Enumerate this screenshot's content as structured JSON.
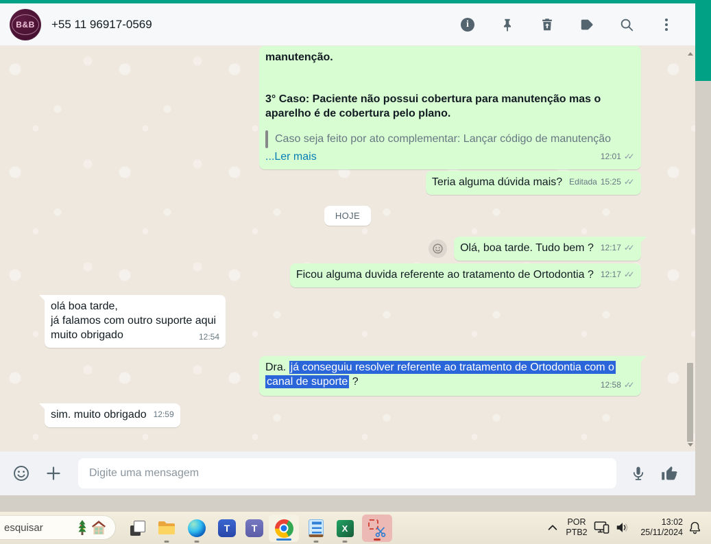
{
  "colors": {
    "accent_teal": "#00a184",
    "outgoing_bubble": "#d9fdd3",
    "incoming_bubble": "#ffffff",
    "selection_blue": "#2a66d9",
    "link_blue": "#027eb5",
    "header_icon_gray": "#54656f",
    "chrome_active_underline": "#2d7dd2",
    "snip_active_bg": "#edb9b4"
  },
  "header": {
    "avatar_text": "B&B",
    "phone": "+55 11 96917-0569"
  },
  "chat": {
    "date_divider": "HOJE",
    "messages": [
      {
        "direction": "outgoing",
        "line1": "manutenção.",
        "line2": "3° Caso: Paciente não possui cobertura para manutenção mas o aparelho é de cobertura pelo plano.",
        "quote": "Caso seja feito por ato complementar: Lançar código de manutenção",
        "read_more": "...Ler mais",
        "time": "12:01"
      },
      {
        "direction": "outgoing",
        "text": "Teria alguma dúvida mais?",
        "meta": "Editada",
        "time": "15:25"
      },
      {
        "direction": "outgoing",
        "text": "Olá, boa tarde. Tudo bem ?",
        "time": "12:17"
      },
      {
        "direction": "outgoing",
        "text": "Ficou alguma duvida referente ao tratamento de Ortodontia ?",
        "time": "12:17"
      },
      {
        "direction": "incoming",
        "lines": [
          "olá boa tarde,",
          "já falamos com outro suporte aqui",
          "muito obrigado"
        ],
        "time": "12:54"
      },
      {
        "direction": "outgoing",
        "prefix": "Dra. ",
        "selected": "já conseguiu resolver referente ao tratamento de Ortodontia com o canal de suporte",
        "suffix": " ?",
        "time": "12:58"
      },
      {
        "direction": "incoming",
        "text": "sim. muito obrigado",
        "time": "12:59"
      }
    ]
  },
  "composer": {
    "placeholder": "Digite uma mensagem"
  },
  "icons": {
    "double_check": "✓✓"
  },
  "taskbar": {
    "search_text": "esquisar",
    "excel_letter": "X",
    "teams_letter": "T",
    "tray": {
      "lang_top": "POR",
      "lang_bottom": "PTB2",
      "time": "13:02",
      "date": "25/11/2024"
    }
  }
}
